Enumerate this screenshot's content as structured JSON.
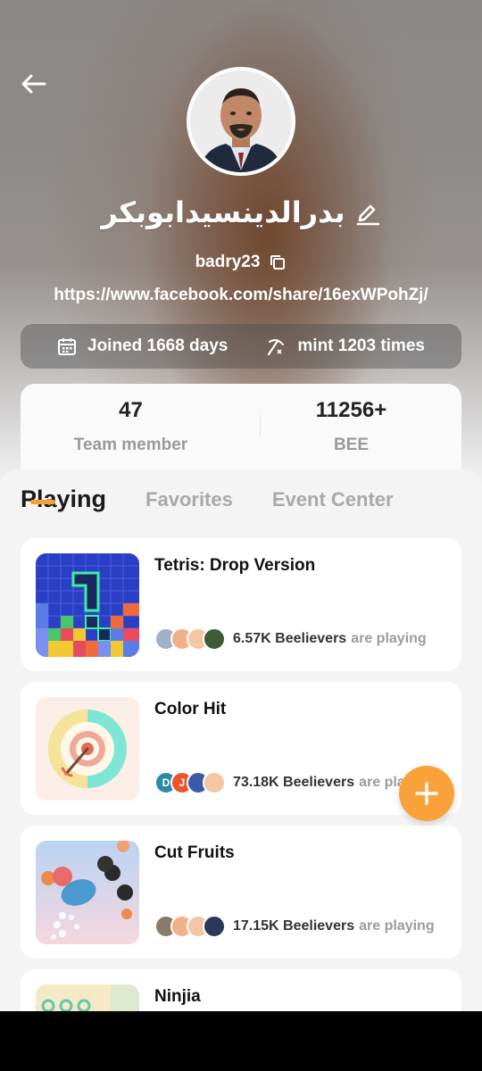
{
  "profile": {
    "name": "بدرالدينسيدابوبكر",
    "username": "badry23",
    "url": "https://www.facebook.com/share/16exWPohZj/",
    "joined": "Joined 1668 days",
    "mint": "mint 1203 times"
  },
  "summary": {
    "team_value": "47",
    "team_label": "Team member",
    "bee_value": "11256+",
    "bee_label": "BEE"
  },
  "tabs": [
    {
      "label": "Playing",
      "active": true
    },
    {
      "label": "Favorites",
      "active": false
    },
    {
      "label": "Event Center",
      "active": false
    }
  ],
  "games": [
    {
      "title": "Tetris: Drop Version",
      "count": "6.57K Beelievers",
      "suffix": "are playing"
    },
    {
      "title": "Color Hit",
      "count": "73.18K Beelievers",
      "suffix": "are playing"
    },
    {
      "title": "Cut Fruits",
      "count": "17.15K Beelievers",
      "suffix": "are playing"
    },
    {
      "title": "Ninjia",
      "count": "",
      "suffix": ""
    }
  ],
  "colors": {
    "accent": "#f7a233",
    "fab": "#f9a23a"
  },
  "icons": [
    "back-arrow-icon",
    "edit-icon",
    "copy-icon",
    "calendar-icon",
    "pickaxe-icon",
    "plus-icon"
  ]
}
